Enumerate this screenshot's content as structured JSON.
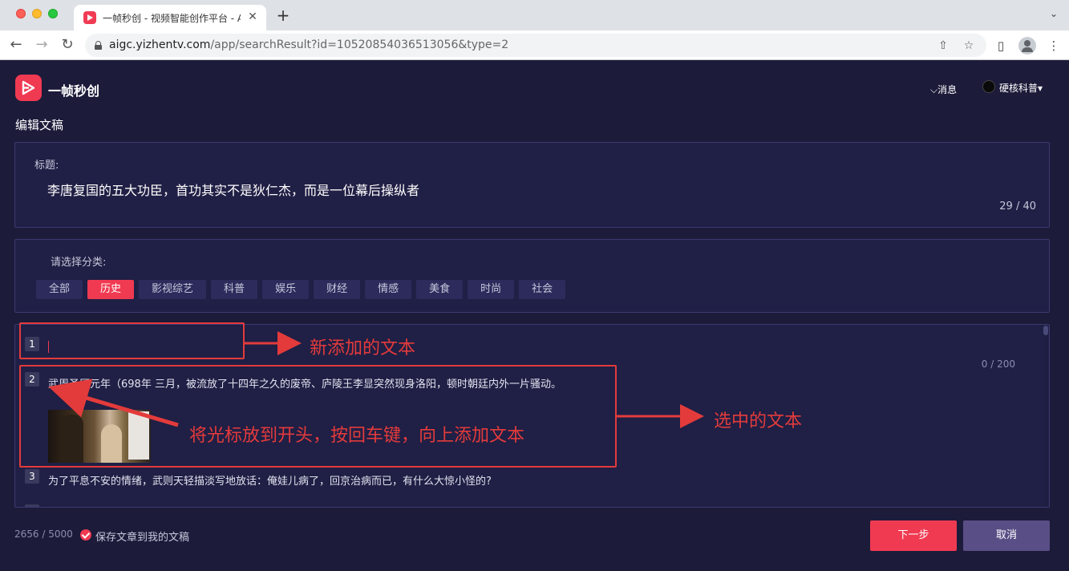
{
  "browser": {
    "tab_title": "一帧秒创 - 视频智能创作平台 - A",
    "url_host": "aigc.yizhentv.com",
    "url_path": "/app/searchResult?id=10520854036513056&type=2"
  },
  "header": {
    "brand": "一帧秒创",
    "messages_label": "⌵消息",
    "user_name": "硬核科普"
  },
  "page_title": "编辑文稿",
  "title_panel": {
    "label": "标题:",
    "value": "李唐复国的五大功臣，首功其实不是狄仁杰，而是一位幕后操纵者",
    "count": "29 / 40"
  },
  "category_panel": {
    "label": "请选择分类:",
    "categories": [
      "全部",
      "历史",
      "影视综艺",
      "科普",
      "娱乐",
      "财经",
      "情感",
      "美食",
      "时尚",
      "社会"
    ],
    "selected": "历史"
  },
  "paragraphs": [
    {
      "num": "1",
      "text": ""
    },
    {
      "num": "2",
      "text": "武周圣历元年（698年 三月，被流放了十四年之久的废帝、庐陵王李显突然现身洛阳，顿时朝廷内外一片骚动。"
    },
    {
      "num": "3",
      "text": "为了平息不安的情绪，武则天轻描淡写地放话：俺娃儿病了，回京治病而已，有什么大惊小怪的?"
    }
  ],
  "paragraph_count": "0 / 200",
  "footer": {
    "total_count": "2656 / 5000",
    "save_label": "保存文章到我的文稿",
    "next_button": "下一步",
    "cancel_button": "取消"
  },
  "annotations": {
    "new_text": "新添加的文本",
    "selected_text": "选中的文本",
    "instruction": "将光标放到开头，按回车键，向上添加文本",
    "color": "#e33b3b"
  },
  "colors": {
    "accent": "#f03a52",
    "background": "#1c1b3a",
    "panel": "#201f45",
    "cancel": "#5a4e86"
  }
}
